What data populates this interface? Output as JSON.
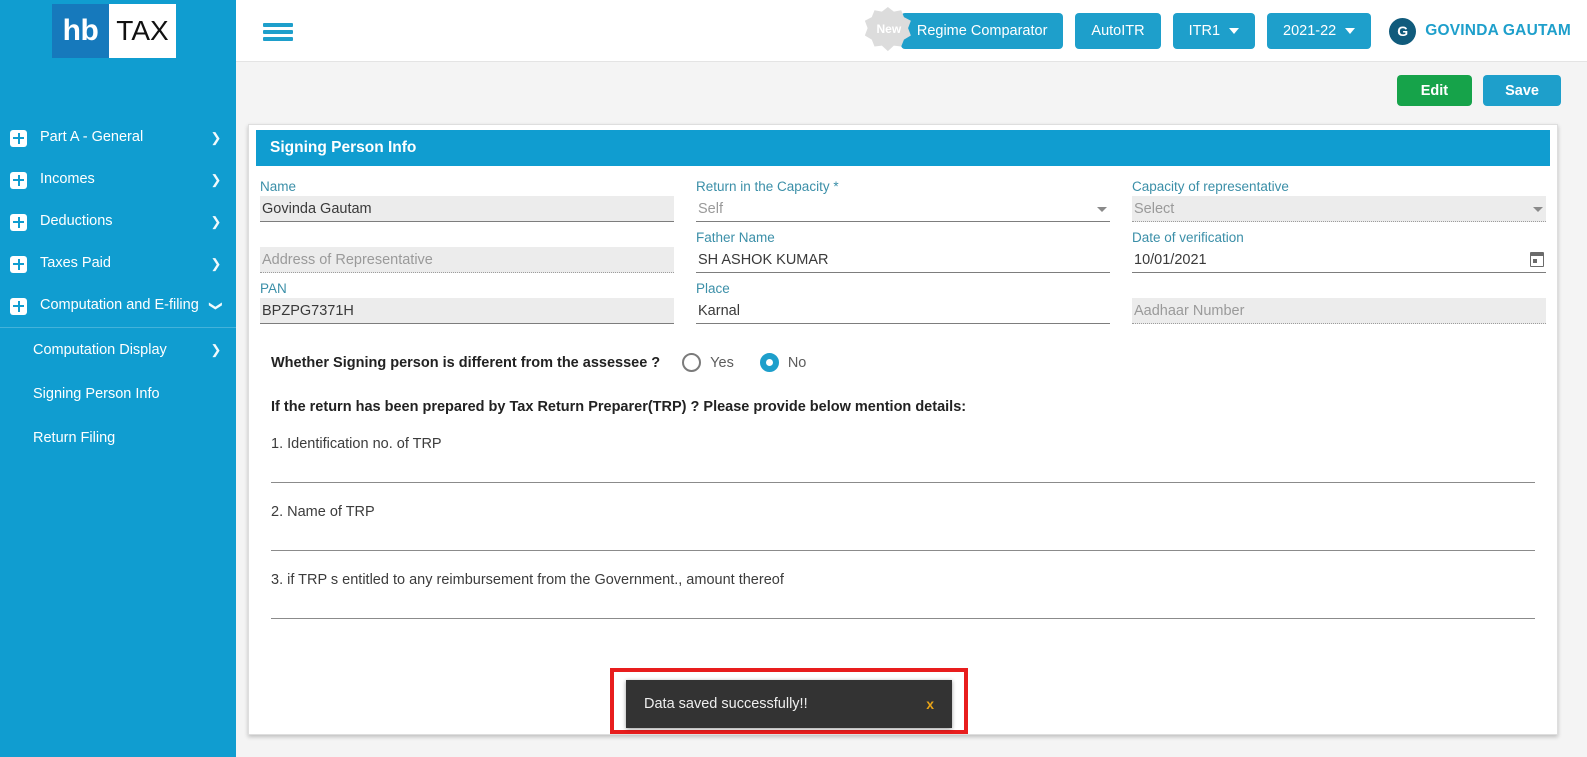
{
  "brand": {
    "logo_left": "hb",
    "logo_right": "TAX"
  },
  "sidebar": {
    "items": [
      {
        "label": "Part A - General",
        "icon": "plus-box-icon",
        "chevron": "chevron-right-icon"
      },
      {
        "label": "Incomes",
        "icon": "plus-box-icon",
        "chevron": "chevron-right-icon"
      },
      {
        "label": "Deductions",
        "icon": "plus-box-icon",
        "chevron": "chevron-right-icon"
      },
      {
        "label": "Taxes Paid",
        "icon": "plus-box-icon",
        "chevron": "chevron-right-icon"
      },
      {
        "label": "Computation and E-filing",
        "icon": "plus-box-icon",
        "chevron": "chevron-down-icon",
        "expanded": true
      }
    ],
    "subitems": [
      {
        "label": "Computation Display",
        "chevron": "chevron-right-icon"
      },
      {
        "label": "Signing Person Info",
        "chevron": ""
      },
      {
        "label": "Return Filing",
        "chevron": ""
      }
    ]
  },
  "topbar": {
    "menu_icon": "hamburger-icon",
    "new_badge": "New",
    "regime_comparator": "Regime Comparator",
    "auto_itr": "AutoITR",
    "itr_type": "ITR1",
    "assessment_year": "2021-22",
    "user_initial": "G",
    "user_name": "GOVINDA GAUTAM"
  },
  "actions": {
    "edit_label": "Edit",
    "save_label": "Save"
  },
  "panel": {
    "title": "Signing Person Info"
  },
  "form": {
    "col1": [
      {
        "label": "Name",
        "value": "Govinda  Gautam",
        "placeholder": "",
        "style": "filled",
        "underline": "solid",
        "control": "text"
      },
      {
        "label": "",
        "value": "",
        "placeholder": "Address of Representative",
        "style": "filled",
        "underline": "dotted",
        "control": "text"
      },
      {
        "label": "PAN",
        "value": "BPZPG7371H",
        "placeholder": "",
        "style": "filled",
        "underline": "solid",
        "control": "text"
      }
    ],
    "col2": [
      {
        "label": "Return in the Capacity *",
        "value": "Self",
        "placeholder": "",
        "style": "plain",
        "underline": "solid",
        "control": "select"
      },
      {
        "label": "Father Name",
        "value": "SH ASHOK KUMAR",
        "placeholder": "",
        "style": "plain",
        "underline": "solid",
        "control": "text"
      },
      {
        "label": "Place",
        "value": "Karnal",
        "placeholder": "",
        "style": "plain",
        "underline": "solid",
        "control": "text"
      }
    ],
    "col3": [
      {
        "label": "Capacity of representative",
        "value": "",
        "placeholder": "Select",
        "style": "filled",
        "underline": "dotted",
        "control": "select"
      },
      {
        "label": "Date of verification",
        "value": "10/01/2021",
        "placeholder": "",
        "style": "plain",
        "underline": "solid",
        "control": "date"
      },
      {
        "label": "",
        "value": "",
        "placeholder": "Aadhaar Number",
        "style": "filled",
        "underline": "dotted",
        "control": "text"
      }
    ]
  },
  "signing_question": {
    "text": "Whether Signing person is different from the assessee ?",
    "options": [
      {
        "label": "Yes",
        "selected": false
      },
      {
        "label": "No",
        "selected": true
      }
    ]
  },
  "trp": {
    "heading": "If the return has been prepared by Tax Return Preparer(TRP) ? Please provide below mention details:",
    "items": [
      {
        "label": "1. Identification no. of TRP",
        "value": ""
      },
      {
        "label": "2. Name of TRP",
        "value": ""
      },
      {
        "label": "3. if TRP s entitled to any reimbursement from the Government., amount thereof",
        "value": ""
      }
    ]
  },
  "toast": {
    "message": "Data saved successfully!!",
    "close_label": "x"
  },
  "colors": {
    "sidebar": "#109dd0",
    "accent": "#1e9fcb",
    "edit_green": "#16a34a",
    "label_blue": "#3b8fa8",
    "toast_bg": "#333333",
    "toast_outline": "#e81d1d",
    "toast_close": "#e8a317",
    "logo_blue": "#1679bc"
  }
}
